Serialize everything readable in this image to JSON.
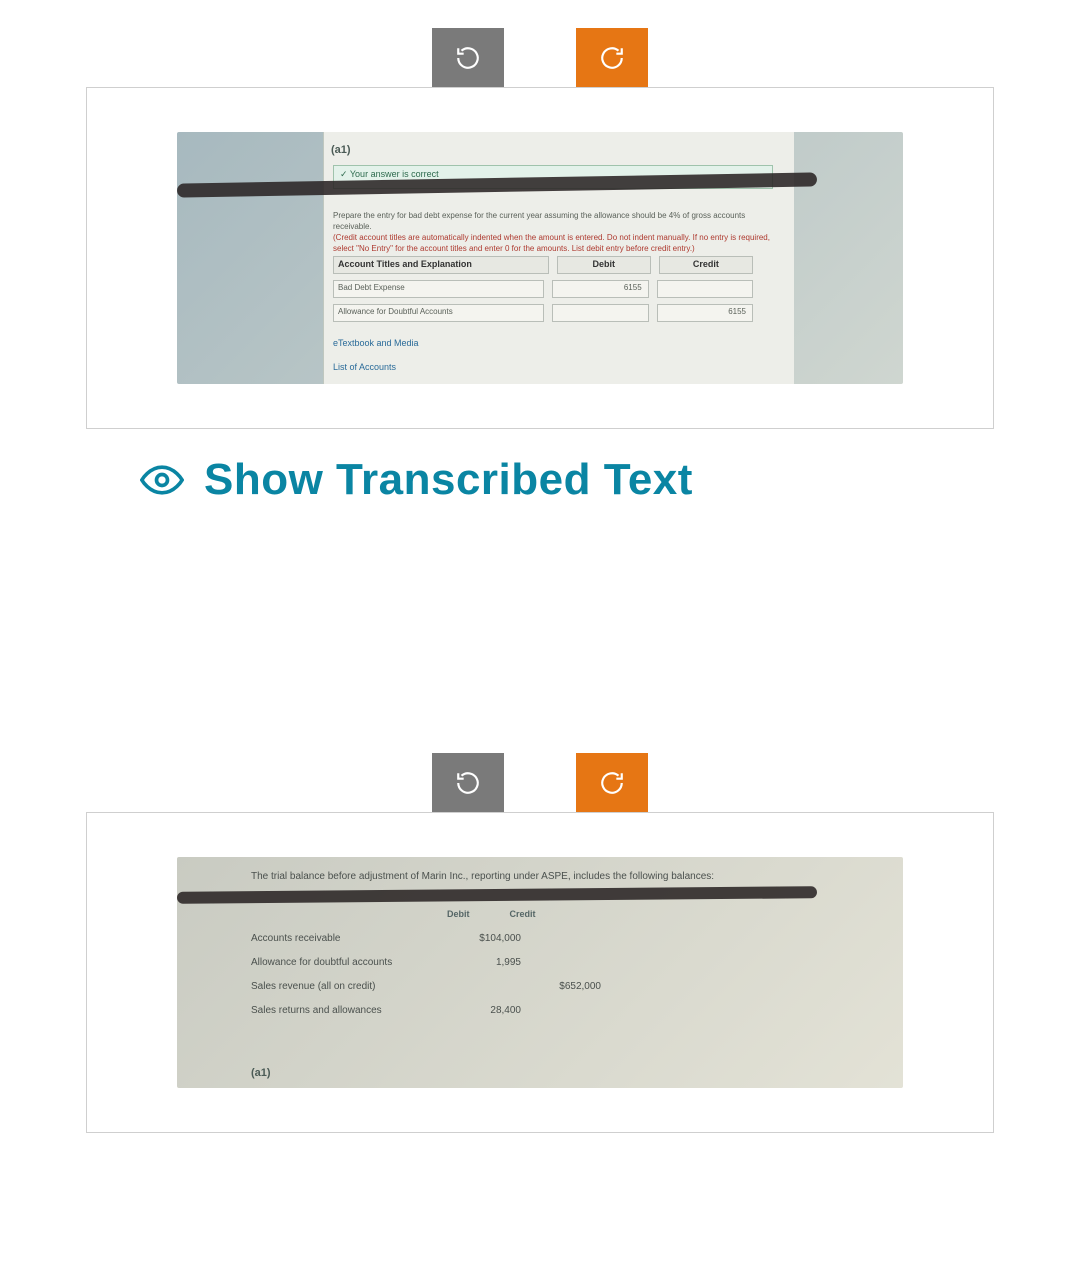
{
  "toolbar": {
    "rotate_left": "rotate-left-icon",
    "rotate_right": "rotate-right-icon"
  },
  "image1": {
    "a1": "(a1)",
    "correct": "✓  Your answer is correct",
    "instr_line1": "Prepare the entry for bad debt expense for the current year assuming the allowance should be 4% of gross accounts receivable.",
    "instr_red": "(Credit account titles are automatically indented when the amount is entered. Do not indent manually. If no entry is required, select \"No Entry\" for the account titles and enter 0 for the amounts. List debit entry before credit entry.)",
    "th": {
      "c1": "Account Titles and Explanation",
      "c2": "Debit",
      "c3": "Credit"
    },
    "rows": [
      {
        "c1": "Bad Debt Expense",
        "c2": "6155",
        "c3": ""
      },
      {
        "c1": "Allowance for Doubtful Accounts",
        "c2": "",
        "c3": "6155"
      }
    ],
    "etext": "eTextbook and Media",
    "la": "List of Accounts"
  },
  "transcribed": {
    "label": "Show Transcribed Text"
  },
  "image2": {
    "intro": "The trial balance before adjustment of Marin Inc., reporting under ASPE, includes the following balances:",
    "hdr": {
      "d": "Debit",
      "c": "Credit"
    },
    "rows": [
      {
        "lab": "Accounts receivable",
        "d": "$104,000",
        "c": ""
      },
      {
        "lab": "Allowance for doubtful accounts",
        "d": "1,995",
        "c": ""
      },
      {
        "lab": "Sales revenue (all on credit)",
        "d": "",
        "c": "$652,000"
      },
      {
        "lab": "Sales returns and allowances",
        "d": "28,400",
        "c": ""
      }
    ],
    "a1": "(a1)"
  }
}
